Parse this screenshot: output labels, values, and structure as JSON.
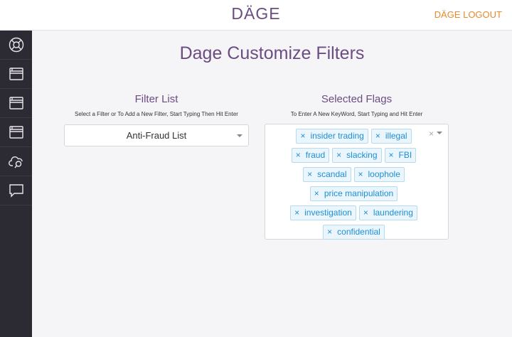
{
  "app": {
    "brand": "DÄGE",
    "logout_label": "DÄGE LOGOUT"
  },
  "sidebar": {
    "items": [
      {
        "icon": "lifebuoy-icon"
      },
      {
        "icon": "window-icon"
      },
      {
        "icon": "window-icon"
      },
      {
        "icon": "window-icon"
      },
      {
        "icon": "cloud-search-icon"
      },
      {
        "icon": "chat-bubble-icon"
      }
    ]
  },
  "main": {
    "title": "Dage Customize Filters",
    "filter_list": {
      "heading": "Filter List",
      "hint": "Select a Filter or To Add a New Filter, Start Typing Then Hit Enter",
      "selected_value": "Anti-Fraud List"
    },
    "selected_flags": {
      "heading": "Selected Flags",
      "hint": "To Enter A New KeyWord, Start Typing and Hit Enter",
      "tags": [
        "insider trading",
        "illegal",
        "fraud",
        "slacking",
        "FBI",
        "scandal",
        "loophole",
        "price manipulation",
        "investigation",
        "laundering",
        "confidential"
      ],
      "remove_glyph": "×",
      "clear_glyph": "×"
    }
  },
  "colors": {
    "brand": "#6b4d83",
    "accent": "#e8892b",
    "tag_text": "#1e8fd5",
    "sidebar_bg": "#2c2a32"
  }
}
